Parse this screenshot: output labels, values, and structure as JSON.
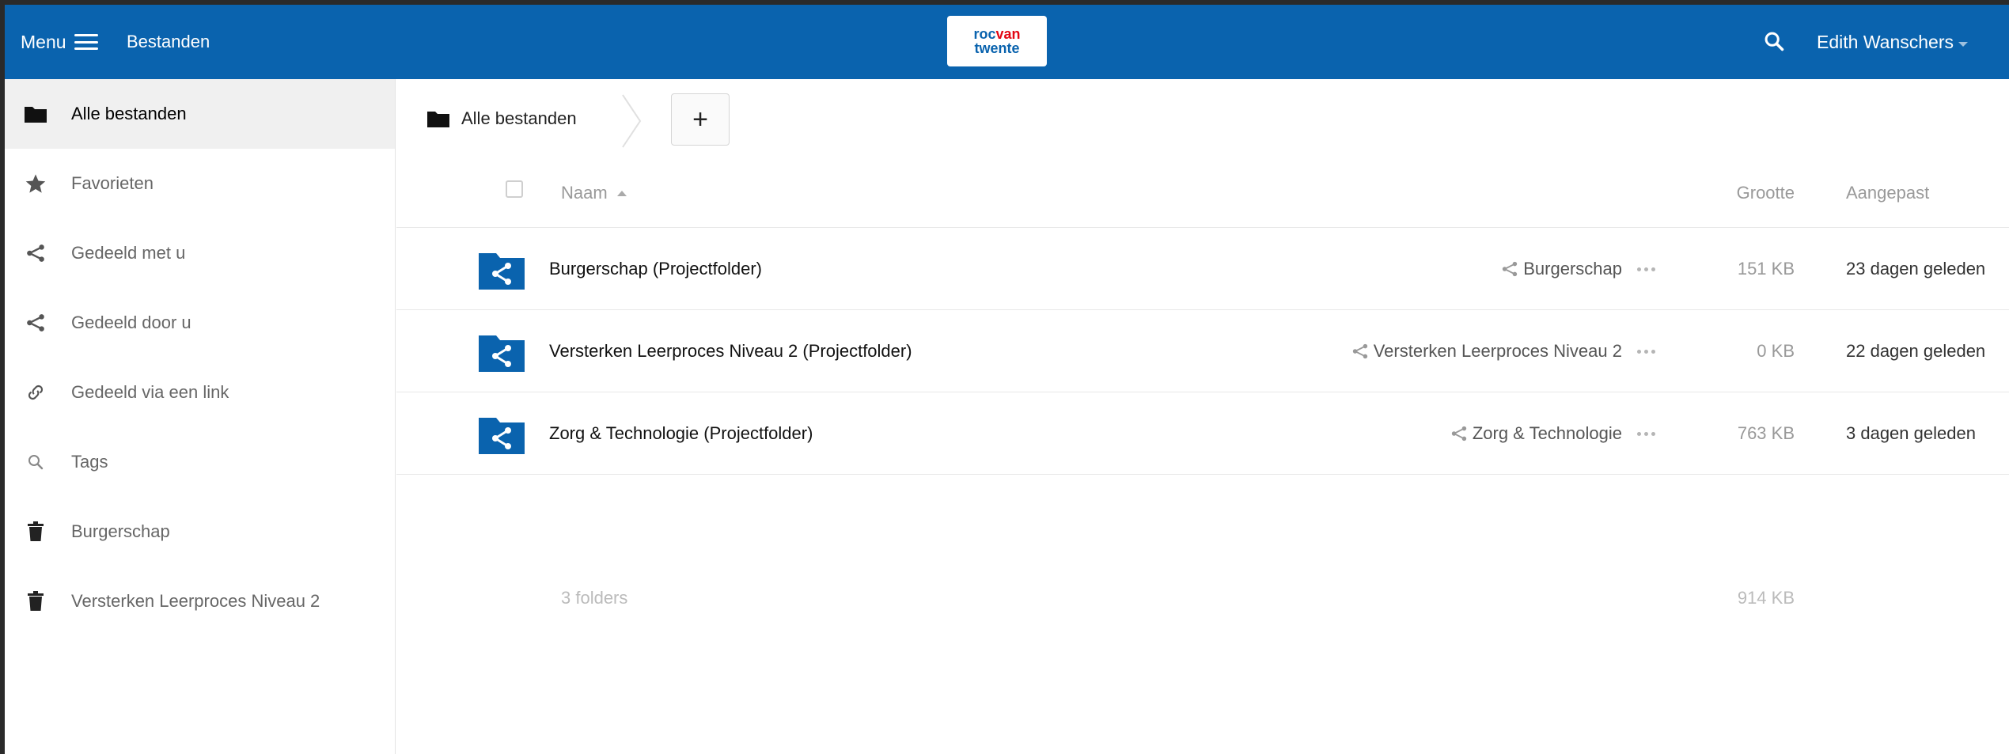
{
  "header": {
    "menu_label": "Menu",
    "app_crumb": "Bestanden",
    "logo_line1_a": "roc",
    "logo_line1_b": "van",
    "logo_line2": "twente",
    "user_name": "Edith Wanschers",
    "bg_color": "#0a63ae"
  },
  "sidebar": {
    "items": [
      {
        "label": "Alle bestanden",
        "icon": "folder-icon",
        "active": true
      },
      {
        "label": "Favorieten",
        "icon": "star-icon"
      },
      {
        "label": "Gedeeld met u",
        "icon": "share-icon"
      },
      {
        "label": "Gedeeld door u",
        "icon": "share-icon"
      },
      {
        "label": "Gedeeld via een link",
        "icon": "link-icon"
      },
      {
        "label": "Tags",
        "icon": "search-icon"
      },
      {
        "label": "Burgerschap",
        "icon": "trash-icon"
      },
      {
        "label": "Versterken Leerproces Niveau 2",
        "icon": "trash-icon"
      }
    ]
  },
  "main": {
    "breadcrumb": "Alle bestanden",
    "add_label": "+",
    "columns": {
      "name": "Naam",
      "size": "Grootte",
      "modified": "Aangepast"
    },
    "files": [
      {
        "name": "Burgerschap (Projectfolder)",
        "share": "Burgerschap",
        "size": "151 KB",
        "modified": "23 dagen geleden"
      },
      {
        "name": "Versterken Leerproces Niveau 2 (Projectfolder)",
        "share": "Versterken Leerproces Niveau 2",
        "size": "0 KB",
        "modified": "22 dagen geleden"
      },
      {
        "name": "Zorg & Technologie (Projectfolder)",
        "share": "Zorg & Technologie",
        "size": "763 KB",
        "modified": "3 dagen geleden"
      }
    ],
    "summary": {
      "count": "3 folders",
      "size": "914 KB"
    },
    "folder_color": "#0a63ae"
  }
}
